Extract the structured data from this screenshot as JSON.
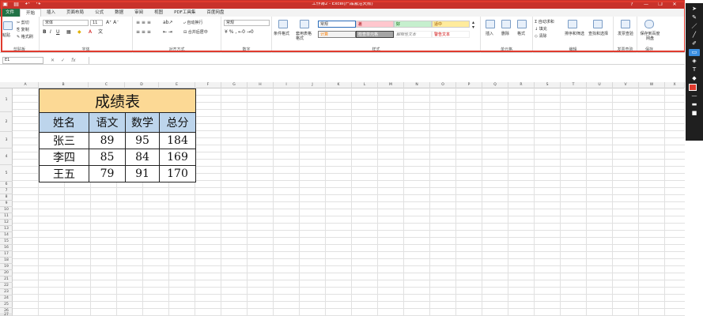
{
  "titlebar": {
    "title": "工作簿2 - Excel(产品激活失败)",
    "controls": [
      "?",
      "—",
      "❐",
      "✕"
    ]
  },
  "tabs": [
    "文件",
    "开始",
    "插入",
    "页面布局",
    "公式",
    "数据",
    "审阅",
    "视图",
    "PDF工具集",
    "百度网盘"
  ],
  "ribbon": {
    "clipboard": {
      "paste": "粘贴",
      "cut": "剪切",
      "copy": "复制",
      "painter": "格式刷",
      "label": "剪贴板"
    },
    "font": {
      "name": "宋体",
      "size": "11",
      "label": "字体"
    },
    "alignment": {
      "wrap": "自动换行",
      "merge": "合并后居中",
      "label": "对齐方式"
    },
    "number": {
      "format": "常规",
      "label": "数字"
    },
    "styles": {
      "conditional": "条件格式",
      "table": "套用表格格式",
      "cells": [
        "常规",
        "差",
        "好",
        "适中",
        "计算",
        "检查单元格",
        "解释性文本",
        "警告文本"
      ],
      "label": "样式"
    },
    "cellsgroup": {
      "insert": "插入",
      "delete": "删除",
      "format": "格式",
      "label": "单元格"
    },
    "editing": {
      "autosum": "自动求和",
      "fill": "填充",
      "clear": "清除",
      "sort": "排序和筛选",
      "find": "查找和选择",
      "label": "编辑"
    },
    "invoice": {
      "btn": "发票查验",
      "label": "发票查验"
    },
    "save": {
      "btn": "保存到百度网盘",
      "label": "保存"
    }
  },
  "formula_bar": {
    "name_box": "E1",
    "icons": [
      "✕",
      "✓",
      "fx"
    ],
    "formula": ""
  },
  "columns": [
    "A",
    "B",
    "C",
    "D",
    "E",
    "F",
    "G",
    "H",
    "I",
    "J",
    "K",
    "L",
    "M",
    "N",
    "O",
    "P",
    "Q",
    "R",
    "S",
    "T",
    "U",
    "V",
    "W",
    "X",
    "Y",
    "Z"
  ],
  "rows": [
    "1",
    "2",
    "3",
    "4",
    "5",
    "6",
    "7",
    "8",
    "9",
    "10",
    "11",
    "12",
    "13",
    "14",
    "15",
    "16",
    "17",
    "18",
    "19",
    "20",
    "21",
    "22",
    "23",
    "24",
    "25",
    "26",
    "27",
    "28",
    "29",
    "30",
    "31",
    "32",
    "33"
  ],
  "table": {
    "title": "成绩表",
    "headers": [
      "姓名",
      "语文",
      "数学",
      "总分"
    ],
    "rows": [
      [
        "张三",
        "89",
        "95",
        "184"
      ],
      [
        "李四",
        "85",
        "84",
        "169"
      ],
      [
        "王五",
        "79",
        "91",
        "170"
      ]
    ]
  },
  "colors": {
    "title_bar": "#c8322b",
    "file_tab": "#217346",
    "title_fill": "#fcd995",
    "header_fill": "#bdd5ec",
    "highlight": "#e03a2e"
  }
}
